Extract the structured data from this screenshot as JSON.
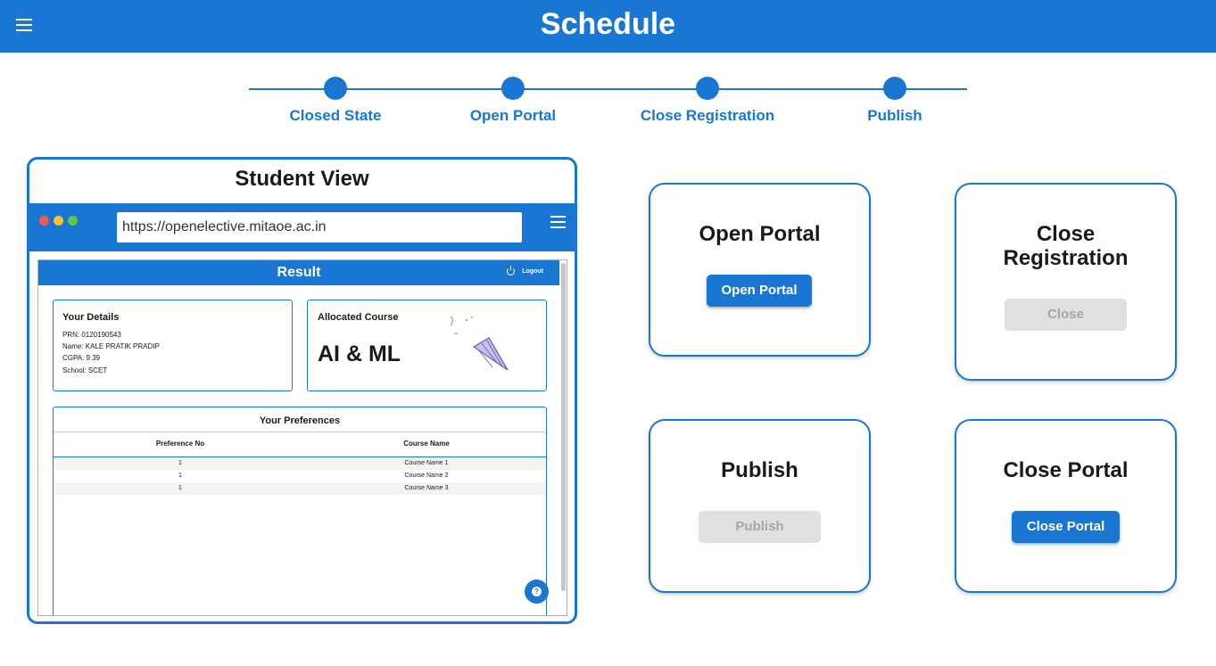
{
  "header": {
    "title": "Schedule",
    "menu_icon": "menu-icon"
  },
  "stepper": {
    "steps": [
      {
        "label": "Closed State"
      },
      {
        "label": "Open Portal"
      },
      {
        "label": "Close Registration"
      },
      {
        "label": "Publish"
      }
    ]
  },
  "student_view": {
    "title": "Student View",
    "browser": {
      "url": "https://openelective.mitaoe.ac.in",
      "traffic_colors": [
        "#ec5b57",
        "#f5bf2f",
        "#5cc93f"
      ]
    },
    "app": {
      "title": "Result",
      "logout_label": "Logout",
      "details": {
        "heading": "Your Details",
        "lines": [
          "PRN: 0120190543",
          "Name: KALE PRATIK PRADIP",
          "CGPA: 9.39",
          "School: SCET"
        ]
      },
      "allocated": {
        "heading": "Allocated Course",
        "course": "AI & ML"
      },
      "preferences": {
        "heading": "Your Preferences",
        "columns": [
          "Preference No",
          "Course Name"
        ],
        "rows": [
          {
            "pref": "1",
            "course": "Course Name 1"
          },
          {
            "pref": "1",
            "course": "Course Name 2"
          },
          {
            "pref": "1",
            "course": "Course Name 3"
          }
        ]
      },
      "help_label": "?"
    }
  },
  "actions": {
    "open_portal": {
      "title": "Open Portal",
      "button": "Open Portal",
      "enabled": true
    },
    "close_registration": {
      "title_line1": "Close",
      "title_line2": "Registration",
      "button": "Close",
      "enabled": false
    },
    "publish": {
      "title": "Publish",
      "button": "Publish",
      "enabled": false
    },
    "close_portal": {
      "title": "Close Portal",
      "button": "Close Portal",
      "enabled": true
    }
  },
  "colors": {
    "primary": "#1976d2",
    "disabled_bg": "#e0e0e0",
    "disabled_text": "#a6a6a6"
  }
}
